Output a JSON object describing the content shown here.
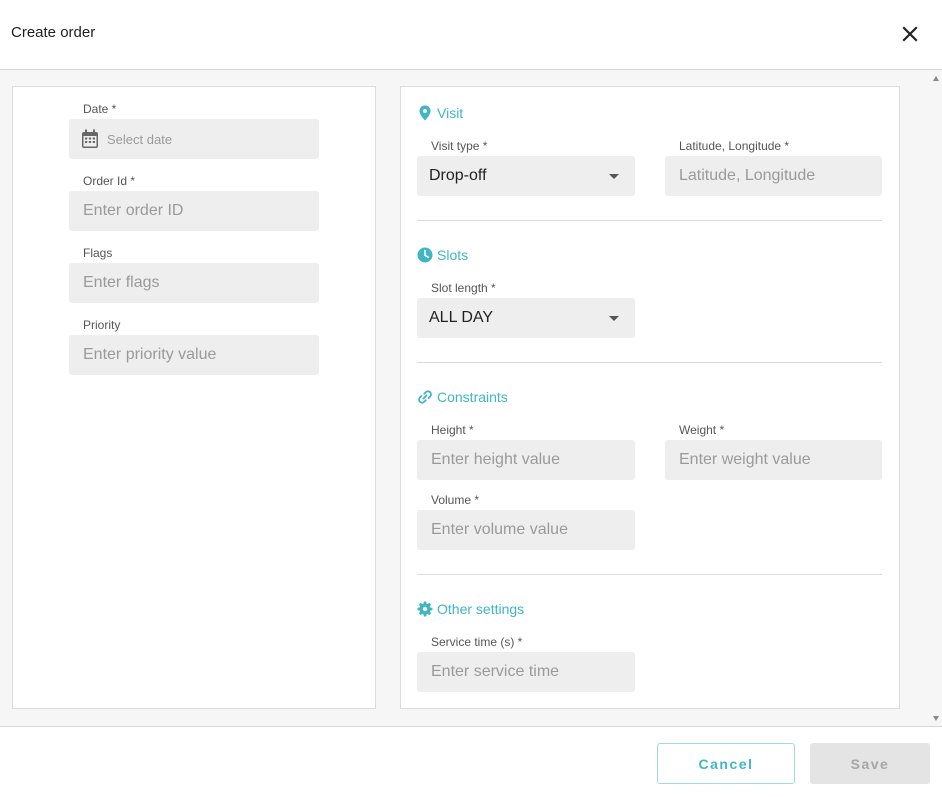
{
  "dialog": {
    "title": "Create order"
  },
  "left_panel": {
    "date": {
      "label": "Date *",
      "placeholder": "Select date"
    },
    "order_id": {
      "label": "Order Id *",
      "placeholder": "Enter order ID"
    },
    "flags": {
      "label": "Flags",
      "placeholder": "Enter flags"
    },
    "priority": {
      "label": "Priority",
      "placeholder": "Enter priority value"
    }
  },
  "right_panel": {
    "visit": {
      "title": "Visit",
      "icon": "location-pin-icon",
      "visit_type": {
        "label": "Visit type *",
        "value": "Drop-off"
      },
      "lat_lng": {
        "label": "Latitude, Longitude *",
        "placeholder": "Latitude, Longitude"
      }
    },
    "slots": {
      "title": "Slots",
      "icon": "clock-icon",
      "slot_length": {
        "label": "Slot length *",
        "value": "ALL DAY"
      }
    },
    "constraints": {
      "title": "Constraints",
      "icon": "link-icon",
      "height": {
        "label": "Height *",
        "placeholder": "Enter height value"
      },
      "weight": {
        "label": "Weight *",
        "placeholder": "Enter weight value"
      },
      "volume": {
        "label": "Volume *",
        "placeholder": "Enter volume value"
      }
    },
    "other_settings": {
      "title": "Other settings",
      "icon": "gear-icon",
      "service_time": {
        "label": "Service time (s) *",
        "placeholder": "Enter service time"
      }
    }
  },
  "footer": {
    "cancel_label": "Cancel",
    "save_label": "Save"
  },
  "colors": {
    "accent": "#3fb6c6",
    "field_bg": "#eeeeee",
    "disabled_bg": "#e4e4e4"
  }
}
